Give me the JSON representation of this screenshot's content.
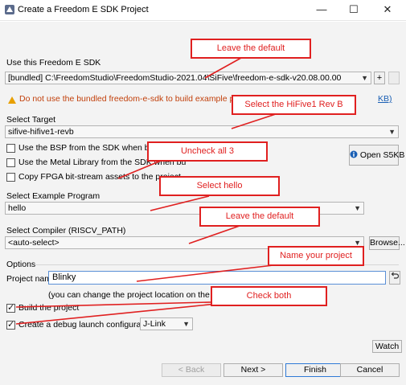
{
  "window": {
    "title": "Create a Freedom E SDK Project",
    "minimize": "—",
    "maximize": "☐",
    "close": "✕"
  },
  "sdk": {
    "label": "Use this Freedom E SDK",
    "value": "[bundled] C:\\FreedomStudio\\FreedomStudio-2021.04\\SiFive\\freedom-e-sdk-v20.08.00.00",
    "add_label": "+",
    "warning": "Do not use the bundled freedom-e-sdk to build example projects for an",
    "warning_link": "KB)"
  },
  "target": {
    "label": "Select Target",
    "value": "sifive-hifive1-revb",
    "options": [
      {
        "label": "Use the BSP from the SDK when building thi",
        "checked": false
      },
      {
        "label": "Use the Metal Library from the SDK when bu",
        "checked": false
      },
      {
        "label": "Copy FPGA bit-stream assets to the project",
        "checked": false
      }
    ],
    "open_button": "Open S5KB"
  },
  "example": {
    "label": "Select Example Program",
    "value": "hello"
  },
  "compiler": {
    "label": "Select Compiler (RISCV_PATH)",
    "value": "<auto-select>",
    "browse": "Browse..."
  },
  "options": {
    "label": "Options",
    "project_name_label": "Project name",
    "project_name": "Blinky",
    "hint": "(you can change the project location on the next page",
    "build_label": "Build the project",
    "build_checked": true,
    "debug_label": "Create a debug launch configuration for",
    "debug_checked": true,
    "debug_probe": "J-Link"
  },
  "buttons": {
    "watch": "Watch",
    "back": "< Back",
    "next": "Next >",
    "finish": "Finish",
    "cancel": "Cancel"
  },
  "callouts": {
    "c1": "Leave the default",
    "c2": "Select the HiFive1 Rev B",
    "c3": "Uncheck all 3",
    "c4": "Select hello",
    "c5": "Leave the default",
    "c6": "Name your project",
    "c7": "Check both"
  },
  "colors": {
    "callout": "#e02020",
    "warning": "#c2410c",
    "focus": "#5a8fd6"
  }
}
